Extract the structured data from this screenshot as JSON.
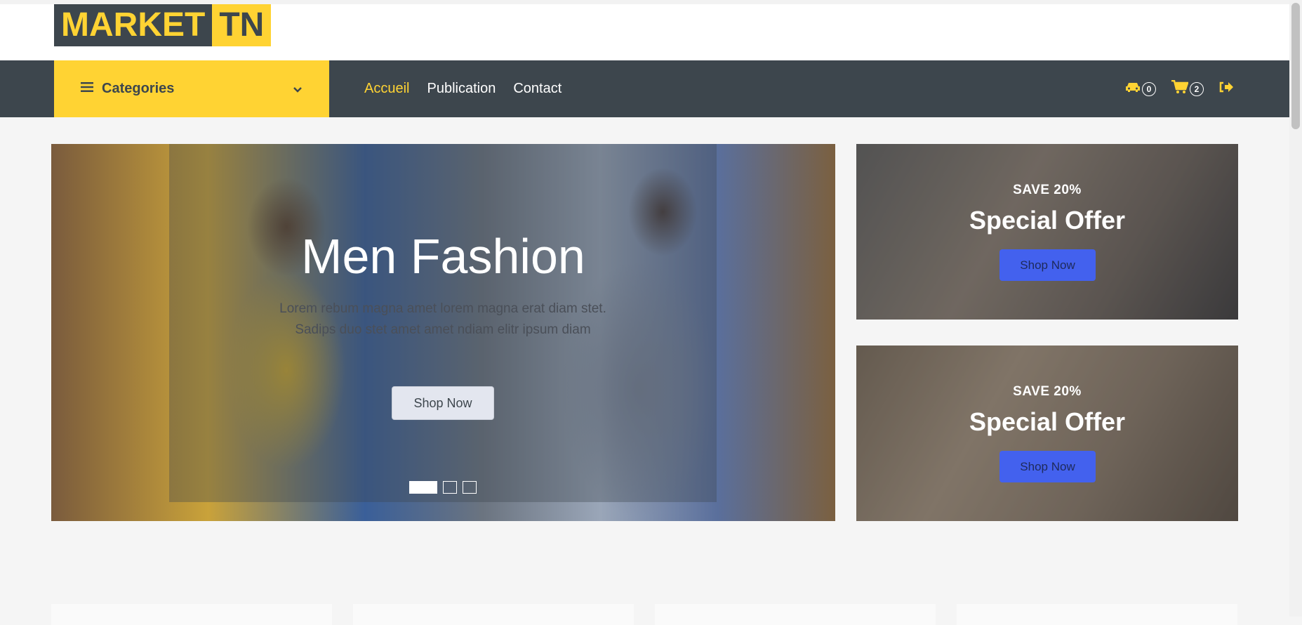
{
  "logo": {
    "part1": "MARKET",
    "part2": "TN"
  },
  "navbar": {
    "categories_label": "Categories",
    "links": [
      {
        "label": "Accueil",
        "active": true
      },
      {
        "label": "Publication",
        "active": false
      },
      {
        "label": "Contact",
        "active": false
      }
    ],
    "car_icon": "car-icon",
    "car_count": "0",
    "cart_icon": "shopping-cart-icon",
    "cart_count": "2",
    "logout_icon": "sign-out-icon"
  },
  "hero": {
    "title": "Men Fashion",
    "description": "Lorem rebum magna amet lorem magna erat diam stet. Sadips duo stet amet amet ndiam elitr ipsum diam",
    "button_label": "Shop Now",
    "slides_total": 3,
    "slide_active": 1
  },
  "offers": [
    {
      "save_text": "SAVE 20%",
      "title": "Special Offer",
      "button_label": "Shop Now"
    },
    {
      "save_text": "SAVE 20%",
      "title": "Special Offer",
      "button_label": "Shop Now"
    }
  ],
  "colors": {
    "accent": "#ffd333",
    "dark": "#3d464d",
    "offer_button": "#4361ee"
  }
}
